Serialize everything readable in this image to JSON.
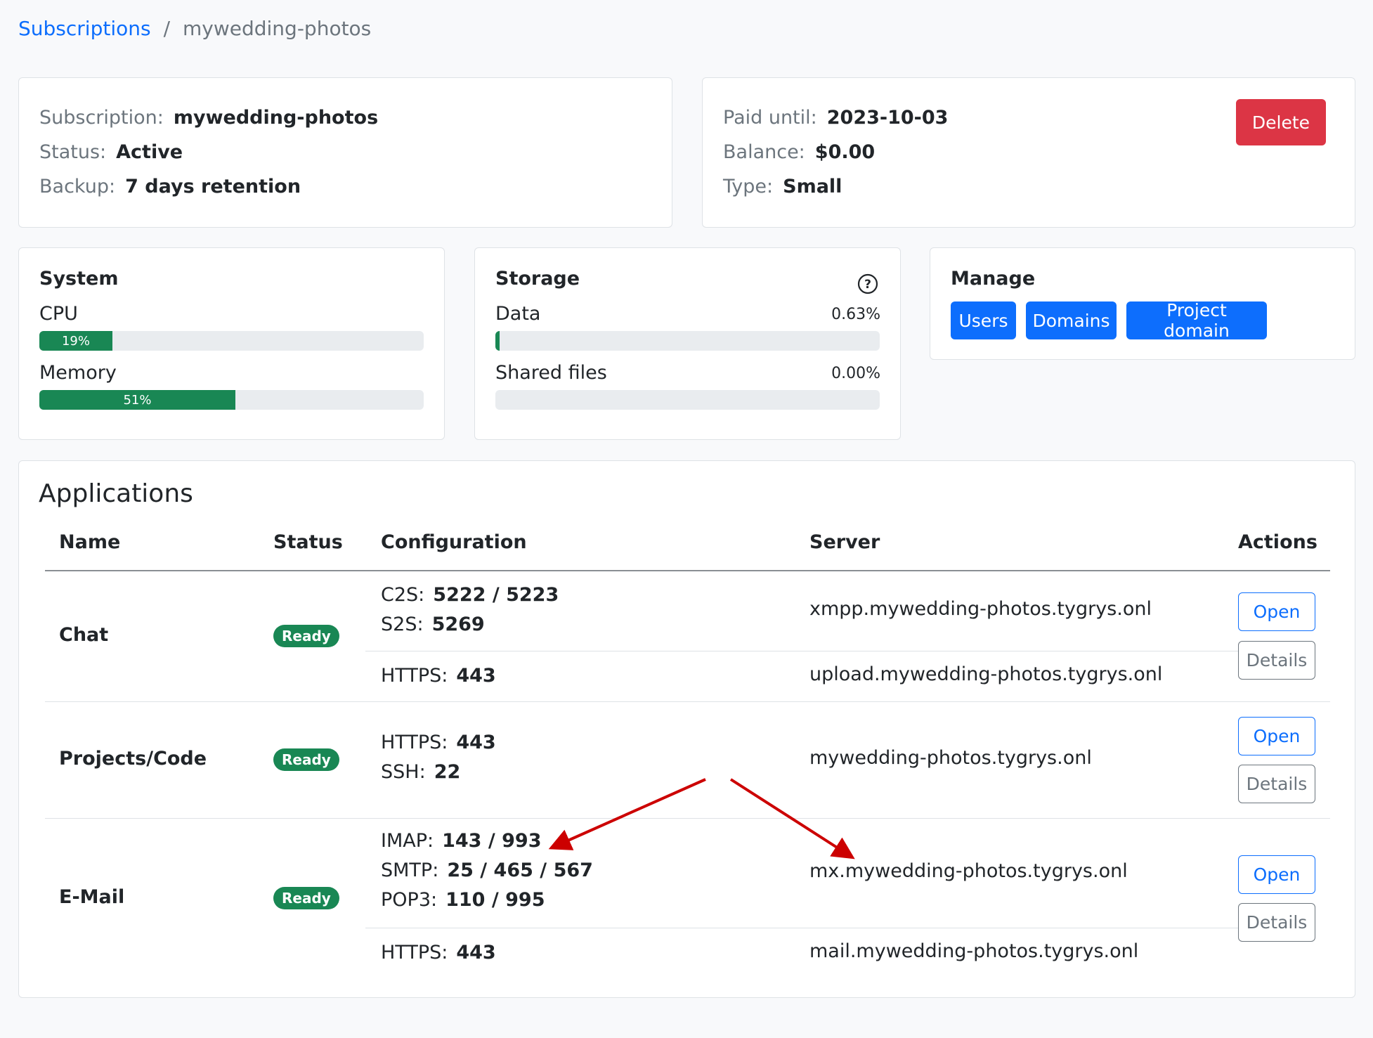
{
  "breadcrumb": {
    "root": "Subscriptions",
    "separator": "/",
    "current": "mywedding-photos"
  },
  "subscription": {
    "name_label": "Subscription:",
    "name": "mywedding-photos",
    "status_label": "Status:",
    "status": "Active",
    "backup_label": "Backup:",
    "backup": "7 days retention"
  },
  "billing": {
    "paid_label": "Paid until:",
    "paid_until": "2023-10-03",
    "balance_label": "Balance:",
    "balance": "$0.00",
    "type_label": "Type:",
    "type": "Small",
    "delete_label": "Delete"
  },
  "system": {
    "title": "System",
    "cpu_label": "CPU",
    "cpu_percent": 19,
    "cpu_text": "19%",
    "memory_label": "Memory",
    "memory_percent": 51,
    "memory_text": "51%"
  },
  "storage": {
    "title": "Storage",
    "help_icon": "question-circle-icon",
    "data_label": "Data",
    "data_percent": 0.63,
    "data_text": "0.63%",
    "shared_label": "Shared files",
    "shared_percent": 0.0,
    "shared_text": "0.00%"
  },
  "manage": {
    "title": "Manage",
    "users": "Users",
    "domains": "Domains",
    "project_domain": "Project domain"
  },
  "applications": {
    "title": "Applications",
    "headers": {
      "name": "Name",
      "status": "Status",
      "configuration": "Configuration",
      "server": "Server",
      "actions": "Actions"
    },
    "open_label": "Open",
    "details_label": "Details",
    "rows": [
      {
        "name": "Chat",
        "status": "Ready",
        "groups": [
          {
            "config": [
              {
                "k": "C2S:",
                "v": "5222 / 5223"
              },
              {
                "k": "S2S:",
                "v": "5269"
              }
            ],
            "server": "xmpp.mywedding-photos.tygrys.onl"
          },
          {
            "config": [
              {
                "k": "HTTPS:",
                "v": "443"
              }
            ],
            "server": "upload.mywedding-photos.tygrys.onl"
          }
        ]
      },
      {
        "name": "Projects/Code",
        "status": "Ready",
        "groups": [
          {
            "config": [
              {
                "k": "HTTPS:",
                "v": "443"
              },
              {
                "k": "SSH:",
                "v": "22"
              }
            ],
            "server": "mywedding-photos.tygrys.onl"
          }
        ]
      },
      {
        "name": "E-Mail",
        "status": "Ready",
        "groups": [
          {
            "config": [
              {
                "k": "IMAP:",
                "v": "143 / 993"
              },
              {
                "k": "SMTP:",
                "v": "25 / 465 / 567"
              },
              {
                "k": "POP3:",
                "v": "110 / 995"
              }
            ],
            "server": "mx.mywedding-photos.tygrys.onl"
          },
          {
            "config": [
              {
                "k": "HTTPS:",
                "v": "443"
              }
            ],
            "server": "mail.mywedding-photos.tygrys.onl"
          }
        ]
      }
    ]
  },
  "annotation": {
    "color": "#cc0000"
  }
}
